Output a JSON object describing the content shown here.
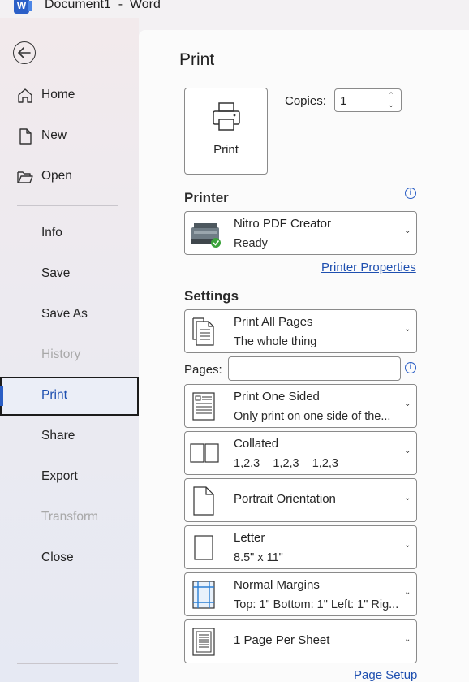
{
  "app": {
    "logo_letter": "W",
    "title": "Document1  -  Word"
  },
  "nav": {
    "items": [
      {
        "label": "Home"
      },
      {
        "label": "New"
      },
      {
        "label": "Open"
      },
      {
        "label": "Info"
      },
      {
        "label": "Save"
      },
      {
        "label": "Save As"
      },
      {
        "label": "History",
        "disabled": true
      },
      {
        "label": "Print",
        "active": true
      },
      {
        "label": "Share"
      },
      {
        "label": "Export"
      },
      {
        "label": "Transform",
        "disabled": true
      },
      {
        "label": "Close"
      }
    ]
  },
  "main": {
    "title": "Print",
    "print_button": "Print",
    "copies_label": "Copies:",
    "copies_value": "1",
    "printer": {
      "header": "Printer",
      "name": "Nitro PDF Creator",
      "status": "Ready",
      "properties_link": "Printer Properties"
    },
    "settings": {
      "header": "Settings",
      "range": {
        "title": "Print All Pages",
        "subtitle": "The whole thing"
      },
      "pages_label": "Pages:",
      "pages_value": "",
      "sides": {
        "title": "Print One Sided",
        "subtitle": "Only print on one side of the..."
      },
      "collation": {
        "title": "Collated",
        "subtitle": "1,2,3    1,2,3    1,2,3"
      },
      "orientation": {
        "title": "Portrait Orientation"
      },
      "paper": {
        "title": "Letter",
        "subtitle": "8.5\" x 11\""
      },
      "margins": {
        "title": "Normal Margins",
        "subtitle": "Top: 1\" Bottom: 1\" Left: 1\" Rig..."
      },
      "per_sheet": {
        "title": "1 Page Per Sheet"
      },
      "page_setup_link": "Page Setup"
    }
  },
  "colors": {
    "accent": "#2a5ec5",
    "link": "#1e4fb0",
    "disabled": "#a8a8a8"
  }
}
